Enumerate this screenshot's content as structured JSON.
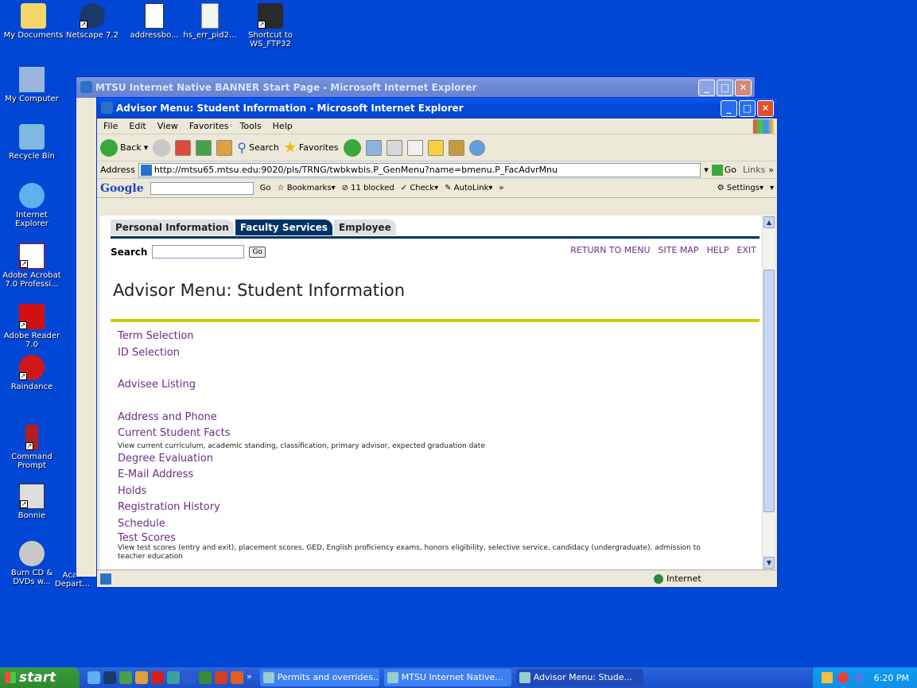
{
  "desktop": {
    "icons_row": [
      {
        "label": "My Documents"
      },
      {
        "label": "Netscape 7.2"
      },
      {
        "label": "addressbo..."
      },
      {
        "label": "hs_err_pid2..."
      },
      {
        "label": "Shortcut to WS_FTP32"
      }
    ],
    "icons_col": [
      {
        "label": "My Computer"
      },
      {
        "label": "Recycle Bin"
      },
      {
        "label": "Internet Explorer"
      },
      {
        "label": "Adobe Acrobat 7.0 Professi..."
      },
      {
        "label": "Adobe Reader 7.0"
      },
      {
        "label": "Raindance"
      },
      {
        "label": "Command Prompt"
      },
      {
        "label": "Bonnie"
      },
      {
        "label": "Burn CD & DVDs w..."
      },
      {
        "label": "Acad Depart..."
      }
    ]
  },
  "back_window": {
    "title": "MTSU Internet Native BANNER Start Page - Microsoft Internet Explorer"
  },
  "window": {
    "title": "Advisor Menu: Student Information - Microsoft Internet Explorer",
    "menu": [
      "File",
      "Edit",
      "View",
      "Favorites",
      "Tools",
      "Help"
    ],
    "toolbar": {
      "back": "Back",
      "search": "Search",
      "favorites": "Favorites"
    },
    "address_label": "Address",
    "url": "http://mtsu65.mtsu.edu:9020/pls/TRNG/twbkwbis.P_GenMenu?name=bmenu.P_FacAdvrMnu",
    "go": "Go",
    "links": "Links",
    "google": {
      "logo": "Google",
      "go": "Go",
      "bookmarks": "Bookmarks",
      "blocked": "11 blocked",
      "check": "Check",
      "autolink": "AutoLink",
      "settings": "Settings"
    },
    "status": "Internet"
  },
  "page": {
    "tabs": [
      "Personal Information",
      "Faculty Services",
      "Employee"
    ],
    "search_label": "Search",
    "search_go": "Go",
    "top_links": [
      "RETURN TO MENU",
      "SITE MAP",
      "HELP",
      "EXIT"
    ],
    "title": "Advisor Menu: Student Information",
    "items": {
      "term": "Term Selection",
      "id": "ID Selection",
      "advisee": "Advisee Listing",
      "address": "Address and Phone",
      "facts": "Current Student Facts",
      "facts_desc": "View current curriculum, academic standing, classification, primary advisor, expected graduation date",
      "degree": "Degree Evaluation",
      "email": "E-Mail Address",
      "holds": "Holds",
      "reghist": "Registration History",
      "schedule": "Schedule",
      "tests": "Test Scores",
      "tests_desc": "View test scores (entry and exit), placement scores, GED, English proficiency exams, honors eligibility, selective service, candidacy (undergraduate), admission to teacher education"
    }
  },
  "taskbar": {
    "start": "start",
    "tasks": [
      "Permits and overrides...",
      "MTSU Internet Native...",
      "Advisor Menu: Stude..."
    ],
    "clock": "6:20 PM"
  },
  "colors": {
    "desktop": "#0047d6",
    "link": "#6b2d86",
    "tab_active": "#003366",
    "rule": "#cccc00"
  }
}
